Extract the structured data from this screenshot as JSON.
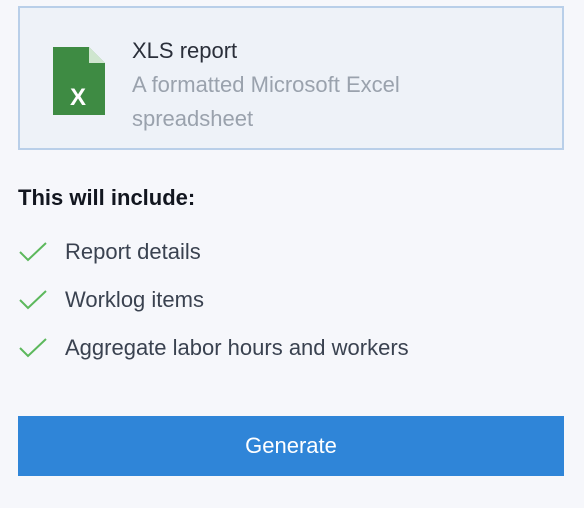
{
  "report": {
    "title": "XLS report",
    "description": "A formatted Microsoft Excel spreadsheet",
    "icon": "excel-file-icon",
    "icon_letter": "X",
    "icon_color": "#3e8b43"
  },
  "includes": {
    "heading": "This will include:",
    "items": [
      {
        "label": "Report details",
        "icon": "checkmark-icon"
      },
      {
        "label": "Worklog items",
        "icon": "checkmark-icon"
      },
      {
        "label": "Aggregate labor hours and workers",
        "icon": "checkmark-icon"
      }
    ],
    "check_color": "#5cb85c"
  },
  "actions": {
    "generate_label": "Generate",
    "button_color": "#2f85d8"
  }
}
